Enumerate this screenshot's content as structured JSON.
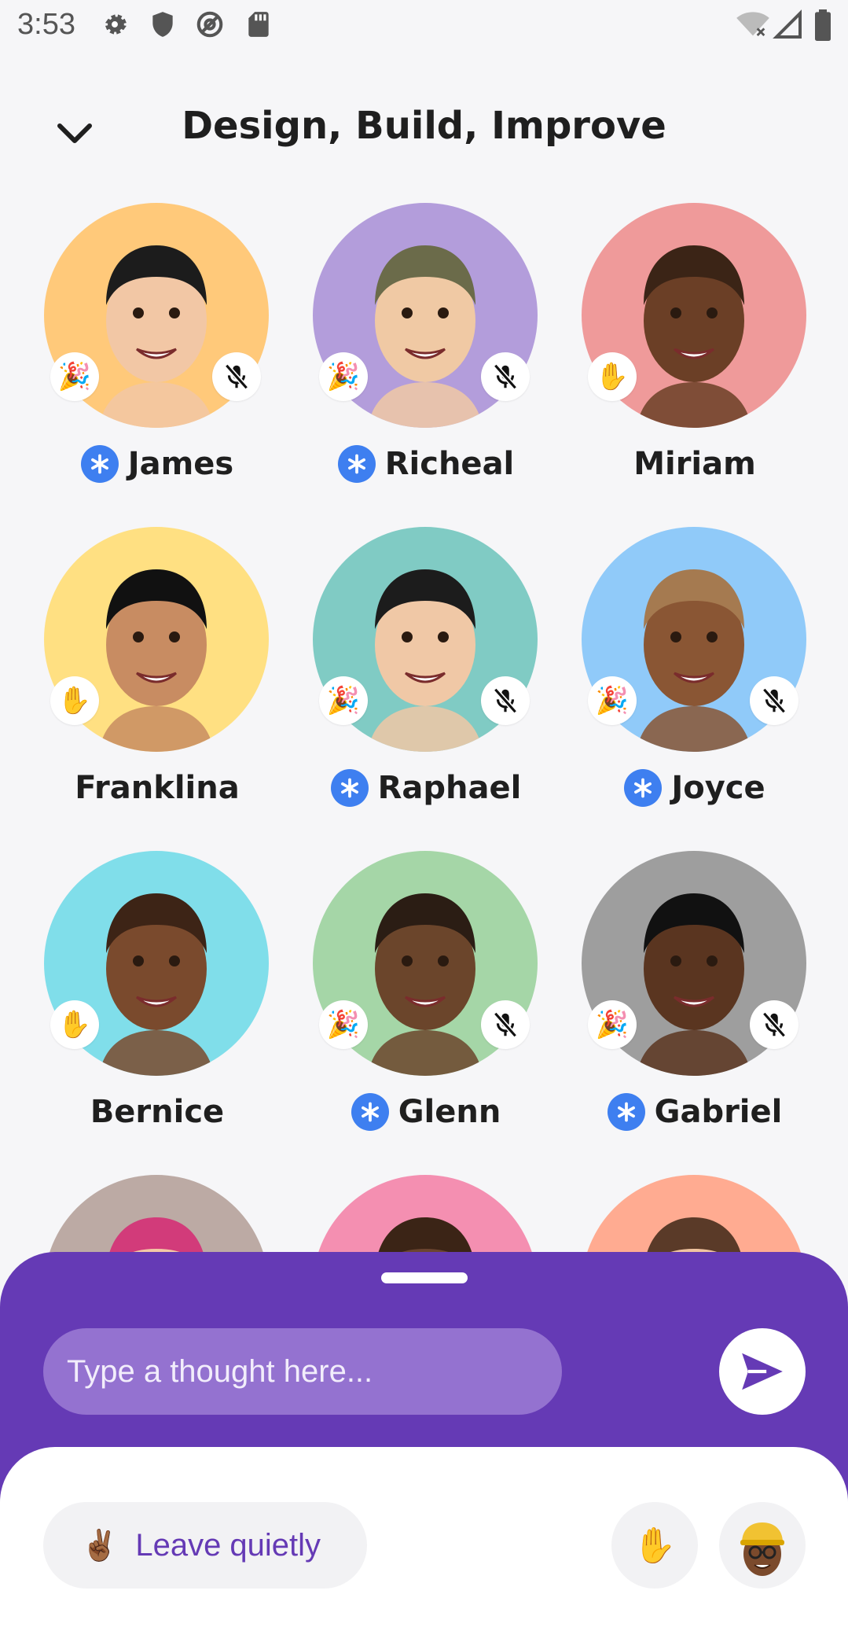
{
  "status_bar": {
    "time": "3:53",
    "left_icons": [
      "settings-icon",
      "shield-icon",
      "at-sign-icon",
      "sd-card-icon"
    ],
    "right_icons": [
      "wifi-off-icon",
      "signal-icon",
      "battery-icon"
    ]
  },
  "header": {
    "title": "Design, Build, Improve",
    "back_icon": "chevron-down-icon"
  },
  "participants": [
    {
      "name": "James",
      "starred": true,
      "reaction": "🎉",
      "muted": true,
      "bg": "#ffc97a"
    },
    {
      "name": "Richeal",
      "starred": true,
      "reaction": "🎉",
      "muted": true,
      "bg": "#b39ddb"
    },
    {
      "name": "Miriam",
      "starred": false,
      "reaction": "✋",
      "muted": false,
      "bg": "#ef9a9a"
    },
    {
      "name": "Franklina",
      "starred": false,
      "reaction": "✋",
      "muted": false,
      "bg": "#ffe082"
    },
    {
      "name": "Raphael",
      "starred": true,
      "reaction": "🎉",
      "muted": true,
      "bg": "#80cbc4"
    },
    {
      "name": "Joyce",
      "starred": true,
      "reaction": "🎉",
      "muted": true,
      "bg": "#90caf9"
    },
    {
      "name": "Bernice",
      "starred": false,
      "reaction": "✋",
      "muted": false,
      "bg": "#80deea"
    },
    {
      "name": "Glenn",
      "starred": true,
      "reaction": "🎉",
      "muted": true,
      "bg": "#a5d6a7"
    },
    {
      "name": "Gabriel",
      "starred": true,
      "reaction": "🎉",
      "muted": true,
      "bg": "#9e9e9e"
    },
    {
      "name": "",
      "starred": false,
      "reaction": "",
      "muted": false,
      "bg": "#bcaaa4"
    },
    {
      "name": "",
      "starred": false,
      "reaction": "",
      "muted": false,
      "bg": "#f48fb1"
    },
    {
      "name": "",
      "starred": false,
      "reaction": "",
      "muted": false,
      "bg": "#ffab91"
    }
  ],
  "bottom_sheet": {
    "thought_placeholder": "Type a thought here...",
    "send_icon": "send-icon",
    "leave_emoji": "✌🏾",
    "leave_label": "Leave quietly",
    "raise_hand_emoji": "✋",
    "accent": "#653ab5"
  }
}
